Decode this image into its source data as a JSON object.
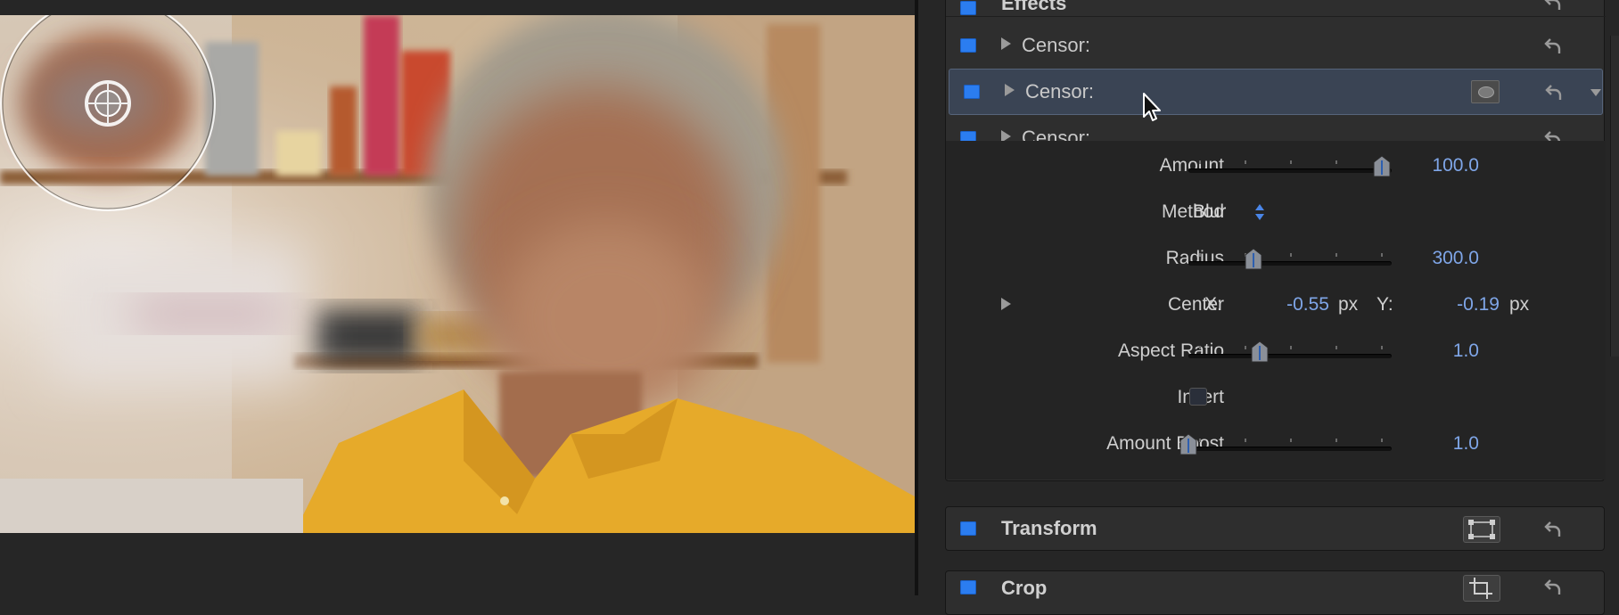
{
  "viewer": {
    "onscreen_control": "circle-crosshair"
  },
  "inspector": {
    "effects_header": "Effects",
    "effects": [
      {
        "label": "Censor:",
        "enabled": true
      },
      {
        "label": "Censor:",
        "enabled": true,
        "selected": true
      },
      {
        "label": "Censor:",
        "enabled": true,
        "expanded": true
      }
    ],
    "params": {
      "amount": {
        "label": "Amount",
        "value": "100.0",
        "level": 0.95
      },
      "method": {
        "label": "Method",
        "value": "Blur"
      },
      "radius": {
        "label": "Radius",
        "value": "300.0",
        "level": 0.32
      },
      "center": {
        "label": "Center",
        "x_label": "X:",
        "x_value": "-0.55",
        "x_unit": "px",
        "y_label": "Y:",
        "y_value": "-0.19",
        "y_unit": "px"
      },
      "aspect_ratio": {
        "label": "Aspect Ratio",
        "value": "1.0",
        "level": 0.35
      },
      "invert": {
        "label": "Invert",
        "checked": false
      },
      "amount_boost": {
        "label": "Amount Boost",
        "value": "1.0",
        "level": 0.0
      }
    },
    "transform": {
      "label": "Transform"
    },
    "crop": {
      "label": "Crop"
    }
  },
  "colors": {
    "accent_blue": "#2b7df0",
    "value_blue": "#7fa6e8",
    "selection_bg": "#3a4454"
  }
}
